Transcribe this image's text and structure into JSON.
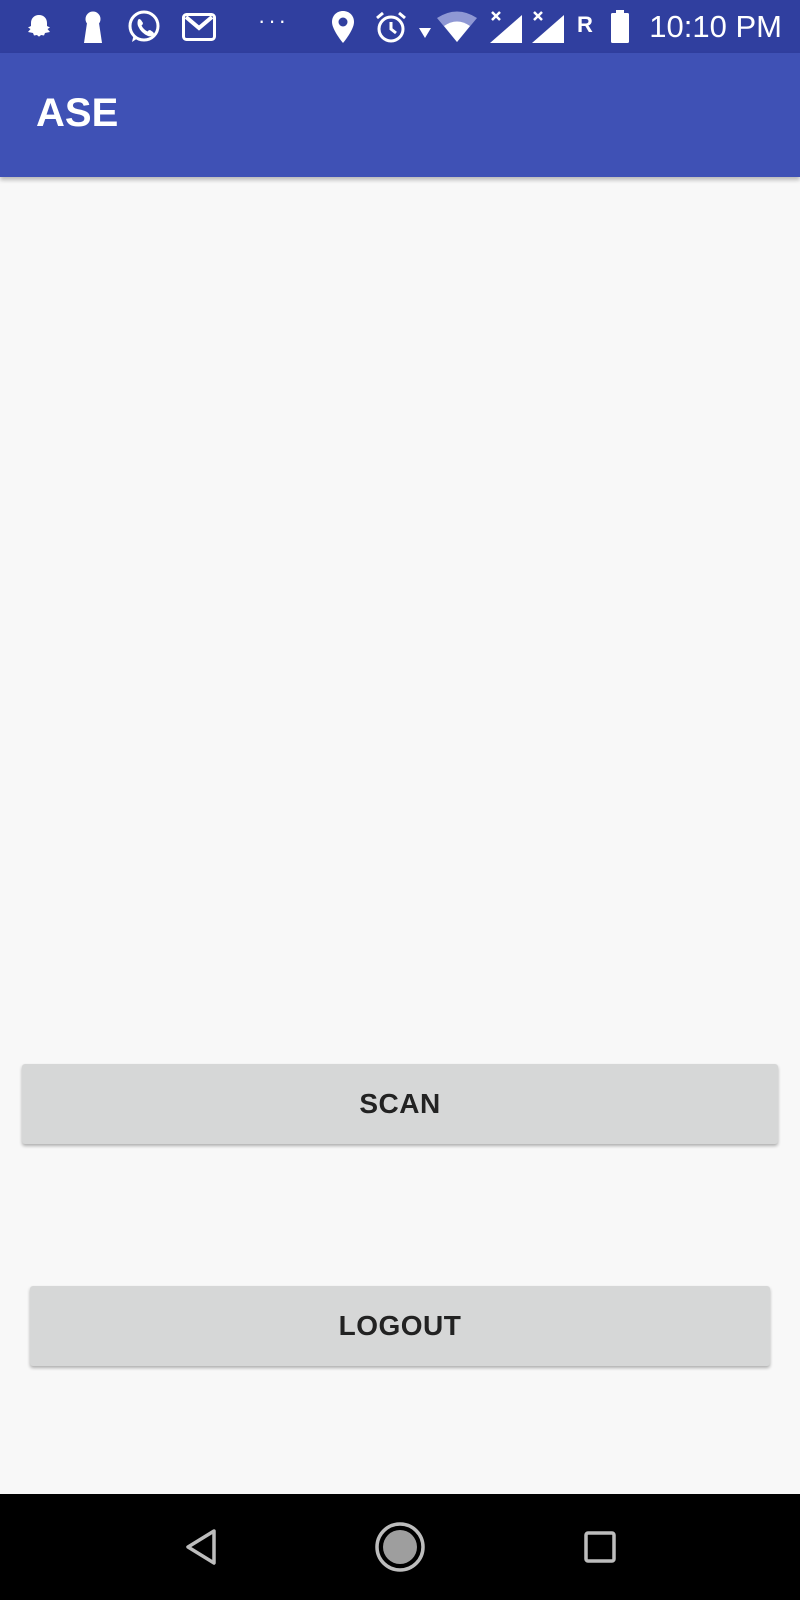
{
  "status_bar": {
    "time": "10:10 PM",
    "roaming": "R",
    "overflow": "···",
    "icons": [
      "snapchat-icon",
      "keyhole-icon",
      "whatsapp-icon",
      "gmail-icon",
      "location-icon",
      "alarm-icon",
      "wifi-icon",
      "signal-icon",
      "signal-icon",
      "battery-icon"
    ]
  },
  "app_bar": {
    "title": "ASE"
  },
  "buttons": {
    "scan": "SCAN",
    "logout": "LOGOUT"
  },
  "nav_bar": {
    "icons": [
      "back-icon",
      "home-icon",
      "recents-icon"
    ]
  },
  "colors": {
    "status_bar": "#303f9f",
    "app_bar": "#3f51b5",
    "background": "#f8f8f8",
    "button": "#d6d7d7",
    "nav_bar": "#000000"
  }
}
